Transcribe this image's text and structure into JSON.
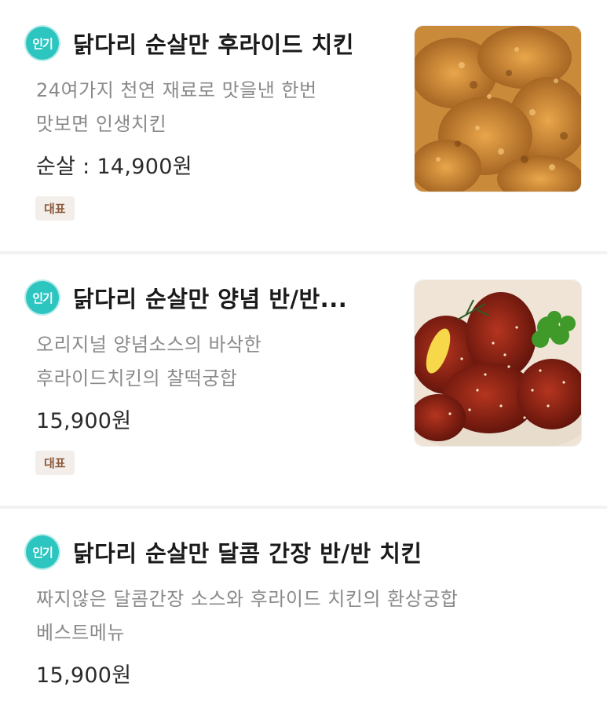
{
  "menu": {
    "items": [
      {
        "badge": "인기",
        "name": "닭다리 순살만 후라이드 치킨",
        "description_lines": [
          "24여가지 천연 재료로 맛을낸 한번",
          "맛보면 인생치킨"
        ],
        "price": "순살 : 14,900원",
        "tag": "대표",
        "image_alt": "fried-chicken-photo"
      },
      {
        "badge": "인기",
        "name": "닭다리 순살만 양념 반/반...",
        "description_lines": [
          "오리지널 양념소스의 바삭한",
          "후라이드치킨의 찰떡궁합"
        ],
        "price": "15,900원",
        "tag": "대표",
        "image_alt": "seasoned-chicken-photo"
      },
      {
        "badge": "인기",
        "name": "닭다리 순살만 달콤 간장 반/반 치킨",
        "description_lines": [
          "짜지않은 달콤간장 소스와 후라이드 치킨의 환상궁합",
          "베스트메뉴"
        ],
        "price": "15,900원"
      }
    ]
  },
  "colors": {
    "badge_bg": "#2cc5c0",
    "tag_bg": "#f3eee9",
    "tag_text": "#8b5a3c"
  }
}
